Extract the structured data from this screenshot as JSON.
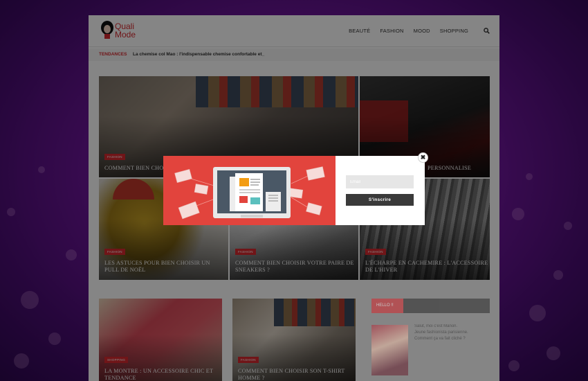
{
  "brand": {
    "logo_line1": "Quali",
    "logo_line2": "Mode"
  },
  "nav": {
    "items": [
      "BEAUTÉ",
      "FASHION",
      "MOOD",
      "SHOPPING"
    ],
    "search_icon": "search-icon"
  },
  "ticker": {
    "label": "TENDANCES",
    "text": "La chemise col Mao : l'indispensable chemise confortable et_"
  },
  "featured": [
    {
      "category": "FASHION",
      "title": "COMMENT BIEN CHOI"
    },
    {
      "category": "",
      "title": "PERSONNALISE"
    },
    {
      "category": "FASHION",
      "title": "LES ASTUCES POUR BIEN CHOISIR UN PULL DE NOËL"
    },
    {
      "category": "FASHION",
      "title": "COMMENT BIEN CHOISIR VOTRE PAIRE DE SNEAKERS ?"
    },
    {
      "category": "FASHION",
      "title": "L'ÉCHARPE EN CACHEMIRE : L'ACCESSOIRE DE L'HIVER"
    }
  ],
  "posts": [
    {
      "category": "SHOPPING",
      "title": "LA MONTRE : UN ACCESSOIRE CHIC ET TENDANCE"
    },
    {
      "category": "FASHION",
      "title": "COMMENT BIEN CHOISIR SON T-SHIRT HOMME ?"
    }
  ],
  "sidebar": {
    "title": "HELLO !!",
    "about_line1": "Salut, moi c'est Manon.",
    "about_line2": "Jeune fashionista parisienne.",
    "about_line3": "Comment ça va fait cliché ?"
  },
  "popup": {
    "email_placeholder": "Email",
    "subscribe_label": "S'inscrire",
    "close_glyph": "✖"
  },
  "colors": {
    "accent": "#d6292e",
    "popup_red": "#e2443d",
    "button_dark": "#3a3a3a",
    "background_purple": "#7a1aa8"
  }
}
